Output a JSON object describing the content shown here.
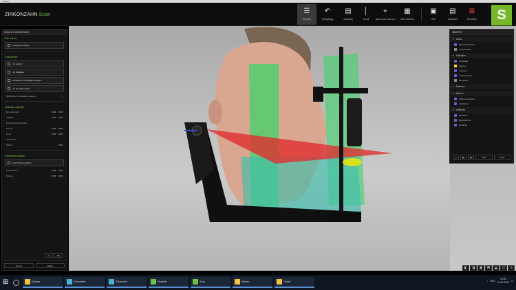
{
  "window": {
    "title": "ZirkOn"
  },
  "brand": {
    "name": "ZIRKONZAHN",
    "product": ".Scan",
    "logo_letter": "S"
  },
  "toolbar": {
    "buttons": [
      {
        "label": "Doppeln",
        "icon": "layers-icon"
      },
      {
        "label": "Rückgängig",
        "icon": "undo-icon"
      },
      {
        "label": "Matching",
        "icon": "matching-icon"
      },
      {
        "label": "Lineal",
        "icon": "ruler-icon"
      },
      {
        "label": "Nach oben scannen",
        "icon": "crosshair-icon"
      },
      {
        "label": "Scan Wechsel",
        "icon": "swap-icon"
      },
      {
        "label": "Hilfe",
        "icon": "help-icon"
      },
      {
        "label": "Speichern",
        "icon": "save-icon"
      },
      {
        "label": "Schließen",
        "icon": "close-icon"
      }
    ]
  },
  "left_panel": {
    "header": "MODELLE ANORDNUNG",
    "section1": "Bitte wählen",
    "option1": "Leitsystem wählen",
    "section2": "Positionieren",
    "items": [
      "mit Leisten",
      "mit Modellen",
      "Modell bis zur Auflage bewegen",
      "mit Frontgebunden"
    ],
    "toggle_label": "Modell nach Artikulator bewegen",
    "section3": "Artikulator Optionen",
    "rows_group1": [
      {
        "label": "Bennettwinkel",
        "v1": "0,00",
        "v2": "0,00"
      },
      {
        "label": "Sagittal",
        "v1": "0,00",
        "v2": "0,00"
      }
    ],
    "subhead2": "Kondylenbahnneigung",
    "rows_group2": [
      {
        "label": "Rechts",
        "v1": "0,00",
        "v2": "0,00"
      },
      {
        "label": "Links",
        "v1": "0,00",
        "v2": "0,00"
      }
    ],
    "subhead3": "Inzisaltisch",
    "rows_group3": [
      {
        "label": "Winkel",
        "v1": "0,00",
        "v2": ""
      }
    ],
    "section4": "Zusätzliche Auswahl",
    "option2": "Aus Profil auswählen",
    "rows_group4": [
      {
        "label": "Verschieben",
        "v1": "0,00",
        "v2": "0,00"
      },
      {
        "label": "Drehen",
        "v1": "0,00",
        "v2": "0,00"
      }
    ],
    "mini_buttons": [
      "↺",
      "OK"
    ],
    "footer_buttons": [
      "Zurück",
      "Weiter"
    ]
  },
  "right_panel": {
    "header": "OBJEKTE",
    "groups": [
      {
        "name": "Scans",
        "items": [
          {
            "label": "Modell Oberkiefer",
            "color": "#6a5acd"
          },
          {
            "label": "Gesichtsscan",
            "color": "#888888"
          }
        ]
      },
      {
        "name": "Artikulator",
        "items": [
          {
            "label": "Artikulator",
            "color": "#6a5acd"
          },
          {
            "label": "Oberteil",
            "color": "#ffd700"
          },
          {
            "label": "Unterteil",
            "color": "#6a5acd"
          },
          {
            "label": "Transferbogen",
            "color": "#6a5acd"
          },
          {
            "label": "Bissgabel",
            "color": "#888888"
          }
        ]
      },
      {
        "name": "Referenz",
        "items": []
      },
      {
        "name": "Ebenen",
        "items": [
          {
            "label": "Okklusionsebene",
            "color": "#6a5acd"
          },
          {
            "label": "Frankfurter",
            "color": "#6a5acd"
          }
        ]
      },
      {
        "name": "Hilfslinien",
        "items": [
          {
            "label": "Mittellinie",
            "color": "#6a5acd"
          },
          {
            "label": "Bipupillarlinie",
            "color": "#6a5acd"
          },
          {
            "label": "Lachlinie",
            "color": "#6a5acd"
          }
        ]
      }
    ],
    "tools": [
      "◻",
      "◧",
      "▣",
      "Alle",
      "Keine"
    ]
  },
  "viewbar": [
    "◧",
    "◨",
    "▣",
    "⬒",
    "⬓",
    "◫",
    "⟲"
  ],
  "taskbar": {
    "apps": [
      {
        "label": "Explorer",
        "color": "#f0c040"
      },
      {
        "label": "Dokumente",
        "color": "#4fb0d6"
      },
      {
        "label": "Zirkonzahn",
        "color": "#4fb0d6"
      },
      {
        "label": "Modellier",
        "color": "#6cc04a"
      },
      {
        "label": "Scan",
        "color": "#6cc04a"
      },
      {
        "label": "Notizen",
        "color": "#f0c040"
      },
      {
        "label": "Ordner",
        "color": "#f0c040"
      }
    ],
    "tray": {
      "lang": "DEU",
      "time": "10:00",
      "date": "01.01.2020"
    }
  }
}
